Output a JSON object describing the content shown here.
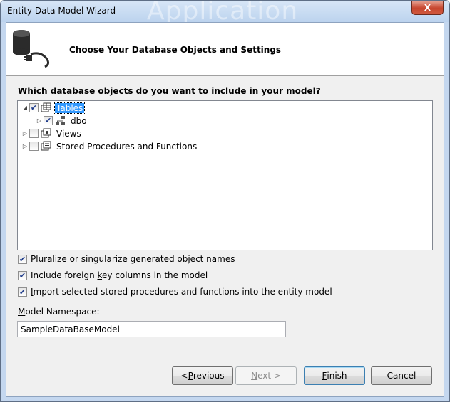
{
  "window": {
    "title": "Entity Data Model Wizard",
    "watermark": "Application",
    "close_label": "X"
  },
  "header": {
    "title": "Choose Your Database Objects and Settings"
  },
  "objects": {
    "label_mnemonic": "W",
    "label_rest": "hich database objects do you want to include in your model?",
    "tree": [
      {
        "label": "Tables",
        "checked": true,
        "expanded": true,
        "selected": true,
        "icon": "tables-icon",
        "children": [
          {
            "label": "dbo",
            "checked": true,
            "expanded": false,
            "icon": "schema-icon"
          }
        ]
      },
      {
        "label": "Views",
        "checked": false,
        "expanded": false,
        "icon": "views-icon"
      },
      {
        "label": "Stored Procedures and Functions",
        "checked": false,
        "expanded": false,
        "icon": "stored-procedures-icon"
      }
    ]
  },
  "options": [
    {
      "pre": "Pluralize or ",
      "mnemonic": "s",
      "post": "ingularize generated object names",
      "checked": true
    },
    {
      "pre": "Include foreign ",
      "mnemonic": "k",
      "post": "ey columns in the model",
      "checked": true
    },
    {
      "pre": "",
      "mnemonic": "I",
      "post": "mport selected stored procedures and functions into the entity model",
      "checked": true
    }
  ],
  "namespace": {
    "label_mnemonic": "M",
    "label_rest": "odel Namespace:",
    "value": "SampleDataBaseModel"
  },
  "buttons": {
    "previous": {
      "pre": "< ",
      "mnemonic": "P",
      "post": "revious",
      "enabled": true
    },
    "next": {
      "pre": "",
      "mnemonic": "N",
      "post": "ext >",
      "enabled": false
    },
    "finish": {
      "pre": "",
      "mnemonic": "F",
      "post": "inish",
      "enabled": true
    },
    "cancel": {
      "label": "Cancel",
      "enabled": true
    }
  },
  "colors": {
    "selection": "#3399ff",
    "window_frame": "#c4d7ef",
    "check": "#1c3a8a"
  }
}
